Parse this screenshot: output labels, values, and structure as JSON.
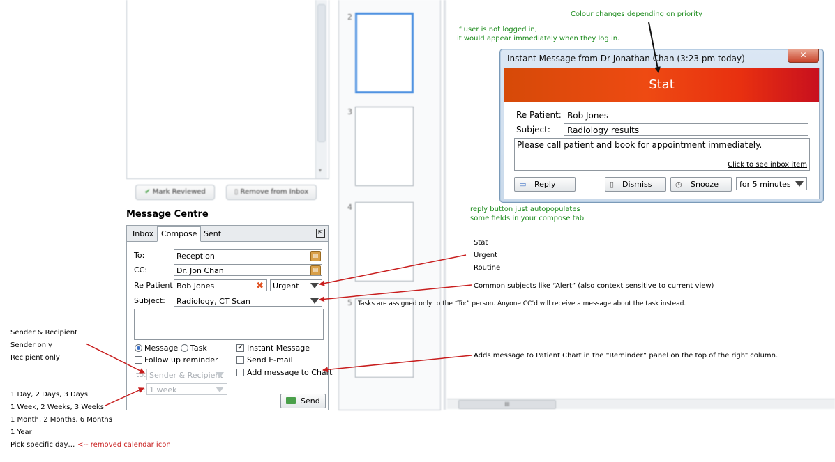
{
  "background": {
    "mark_reviewed_label": "Mark Reviewed",
    "remove_from_inbox_label": "Remove from Inbox",
    "thumbnail_numbers": [
      "2",
      "3",
      "4",
      "5"
    ],
    "hscroll_grip": "III"
  },
  "message_centre": {
    "title": "Message Centre",
    "tabs": [
      {
        "label": "Inbox"
      },
      {
        "label": "Compose"
      },
      {
        "label": "Sent"
      }
    ],
    "to_label": "To:",
    "to_value": "Reception",
    "cc_label": "CC:",
    "cc_value": "Dr. Jon Chan",
    "re_patient_label": "Re Patient:",
    "re_patient_value": "Bob Jones",
    "priority_value": "Urgent",
    "subject_label": "Subject:",
    "subject_value": "Radiology, CT Scan",
    "message_label": "Message",
    "task_label": "Task",
    "instant_message_label": "Instant Message",
    "follow_up_label": "Follow up reminder",
    "send_email_label": "Send E-mail",
    "add_to_chart_label": "Add message to Chart",
    "remind_to_label": "to:",
    "remind_to_value": "Sender & Recipient",
    "remind_in_label": "in:",
    "remind_in_value": "1 week",
    "send_label": "Send"
  },
  "instant_message": {
    "title": "Instant Message from Dr Jonathan Chan (3:23 pm today)",
    "close_glyph": "✕",
    "priority_banner": "Stat",
    "re_patient_label": "Re Patient:",
    "re_patient_value": "Bob Jones",
    "subject_label": "Subject:",
    "subject_value": "Radiology results",
    "message_text": "Please call patient and book for appointment immediately.",
    "inbox_link": "Click to see inbox item",
    "reply_label": "Reply",
    "dismiss_label": "Dismiss",
    "snooze_label": "Snooze",
    "snooze_duration": "for 5 minutes"
  },
  "annotations": {
    "colour_note": "Colour changes depending on priority",
    "not_logged_in_line1": "If user is not logged in,",
    "not_logged_in_line2": "it would appear immediately when they log in.",
    "reply_note_line1": "reply button just autopopulates",
    "reply_note_line2": "some fields in your compose tab",
    "priority_options": [
      "Stat",
      "Urgent",
      "Routine"
    ],
    "subjects_note": "Common subjects like “Alert” (also context sensitive to current view)",
    "tasks_note": "Tasks are assigned only to the “To:” person.  Anyone CC’d will receive a message about the task instead.",
    "recipient_options": [
      "Sender & Recipient",
      "Sender only",
      "Recipient only"
    ],
    "duration_options": [
      "1 Day, 2 Days, 3 Days",
      "1 Week, 2 Weeks, 3 Weeks",
      "1 Month, 2 Months, 6 Months",
      "1 Year",
      "Pick specific day…"
    ],
    "removed_calendar_note": "<-- removed calendar icon",
    "chart_note": "Adds message to Patient Chart in the “Reminder” panel on the top of the right column."
  },
  "colors": {
    "annotation_green": "#1a8a1a",
    "annotation_red": "#c81e1e",
    "stat_banner": "#e83a10"
  }
}
